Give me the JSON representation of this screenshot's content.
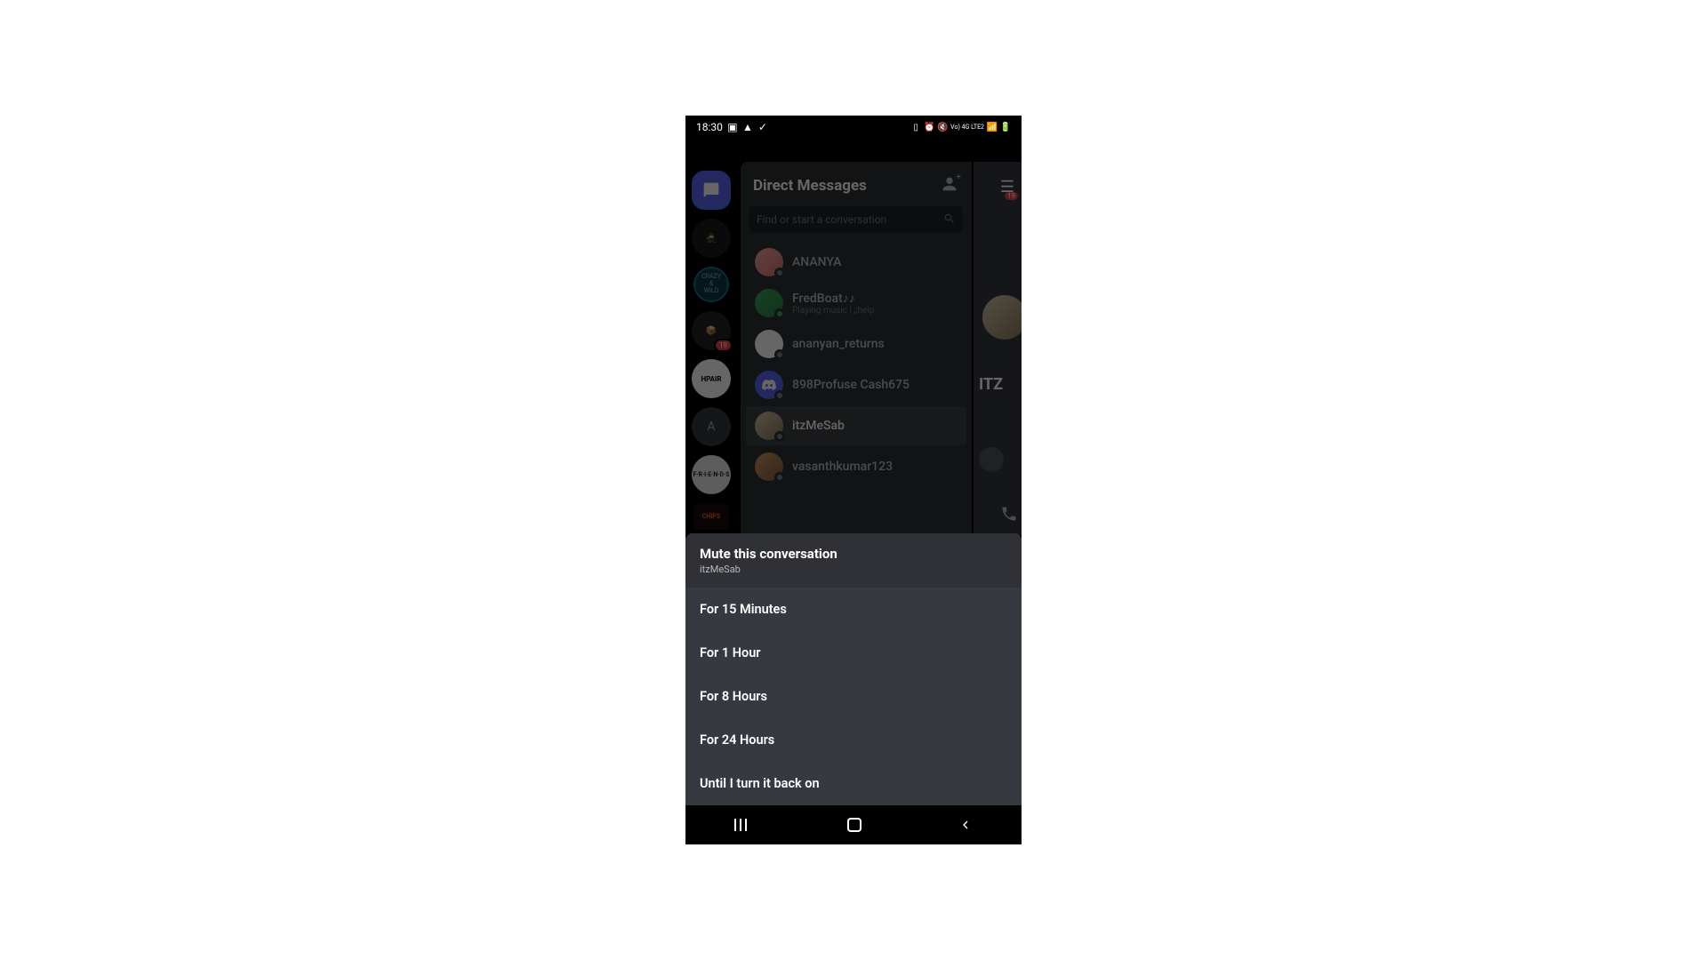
{
  "status_bar": {
    "time": "18:30",
    "network_label": "Vo) 4G LTE2"
  },
  "header": {
    "title": "Direct Messages",
    "menu_badge": "19"
  },
  "search": {
    "placeholder": "Find or start a conversation"
  },
  "server_rail": {
    "hpair_label": "HPAIR",
    "letter_label": "A",
    "cube_badge": "19"
  },
  "dm_list": [
    {
      "name": "ANANYA",
      "sub": ""
    },
    {
      "name": "FredBoat♪♪",
      "sub": "Playing music | ;;help"
    },
    {
      "name": "ananyan_returns",
      "sub": ""
    },
    {
      "name": "898Profuse Cash675",
      "sub": ""
    },
    {
      "name": "itzMeSab",
      "sub": ""
    },
    {
      "name": "vasanthkumar123",
      "sub": ""
    }
  ],
  "right_panel": {
    "name_peek": "ITZ"
  },
  "sheet": {
    "title": "Mute this conversation",
    "subtitle": "itzMeSab",
    "options": [
      "For 15 Minutes",
      "For 1 Hour",
      "For 8 Hours",
      "For 24 Hours",
      "Until I turn it back on"
    ]
  }
}
